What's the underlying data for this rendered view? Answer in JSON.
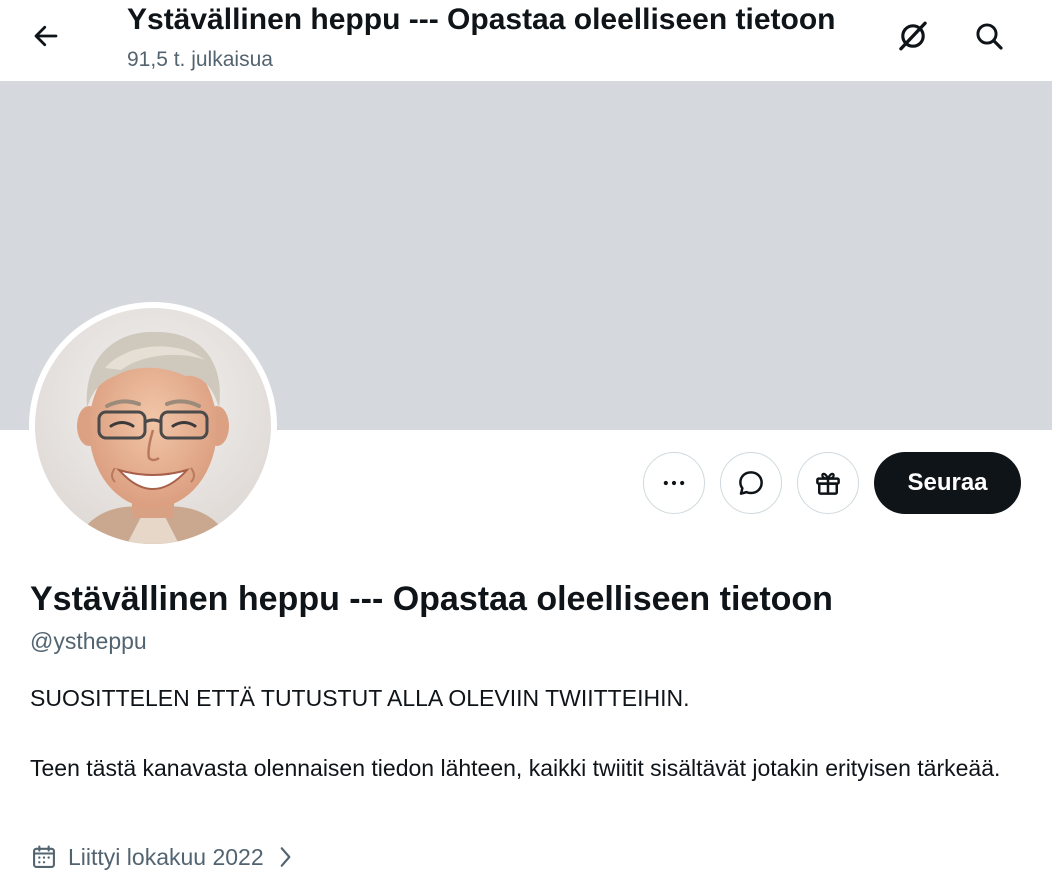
{
  "header": {
    "title": "Ystävällinen heppu --- Opastaa oleelliseen tietoon",
    "post_count": "91,5 t. julkaisua",
    "back_icon": "arrow-left-icon",
    "grok_icon": "grok-slash-icon",
    "search_icon": "search-icon"
  },
  "banner": {
    "color": "#d5d9de"
  },
  "actions": {
    "more_icon": "more-dots-icon",
    "message_icon": "message-bubble-icon",
    "gift_icon": "gift-icon",
    "follow_label": "Seuraa"
  },
  "profile": {
    "display_name": "Ystävällinen heppu --- Opastaa oleelliseen tietoon",
    "handle": "@ystheppu",
    "bio_line1": "SUOSITTELEN ETTÄ TUTUSTUT ALLA OLEVIIN TWIITTEIHIN.",
    "bio_line2": "Teen tästä kanavasta olennaisen tiedon lähteen, kaikki twiitit sisältävät jotakin erityisen tärkeää.",
    "joined": "Liittyi lokakuu 2022"
  },
  "colors": {
    "text_primary": "#0f1419",
    "text_secondary": "#536471",
    "follow_bg": "#0f1419",
    "border": "#cfd9de"
  }
}
